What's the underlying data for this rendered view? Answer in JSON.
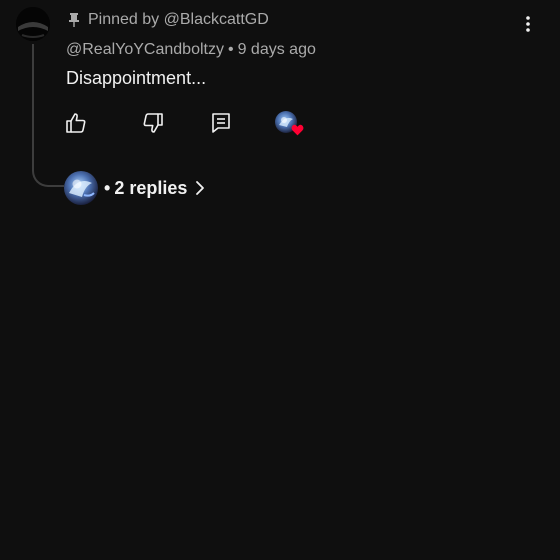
{
  "comment": {
    "pinned_text": "Pinned by @BlackcattGD",
    "author": "@RealYoYCandboltzy",
    "separator": "•",
    "time_ago": "9 days ago",
    "text": "Disappointment..."
  },
  "actions": {
    "like_icon": "thumbs-up-icon",
    "dislike_icon": "thumbs-down-icon",
    "reply_icon": "comment-icon",
    "creator_heart_icon": "creator-heart-icon",
    "more_icon": "more-vert-icon"
  },
  "replies": {
    "separator": "•",
    "label": "2 replies"
  },
  "colors": {
    "background": "#0f0f0f",
    "primary_text": "#f1f1f1",
    "secondary_text": "#aaaaaa",
    "heart": "#ff0033",
    "thread_line": "#3d3d3d"
  }
}
